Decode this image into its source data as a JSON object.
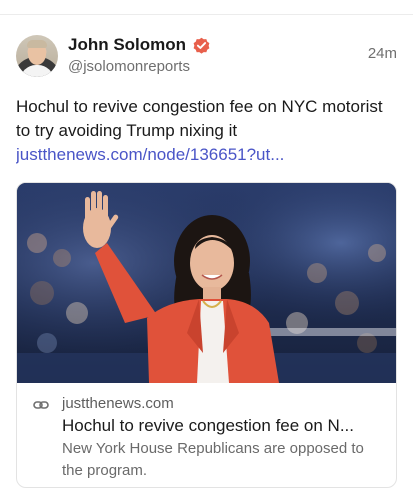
{
  "post": {
    "author_name": "John Solomon",
    "author_handle": "@jsolomonreports",
    "timestamp": "24m",
    "text": "Hochul to revive congestion fee on NYC motorist to try avoiding Trump nixing it",
    "link_text": "justthenews.com/node/136651?ut..."
  },
  "card": {
    "domain": "justthenews.com",
    "title": "Hochul to revive congestion fee on N...",
    "description": "New York House Republicans are opposed to the program."
  },
  "icons": {
    "verified": "verified-badge-icon",
    "link": "link-icon"
  },
  "colors": {
    "verified_badge": "#e8604c",
    "link": "#4a55c7",
    "jacket": "#e0523a"
  }
}
